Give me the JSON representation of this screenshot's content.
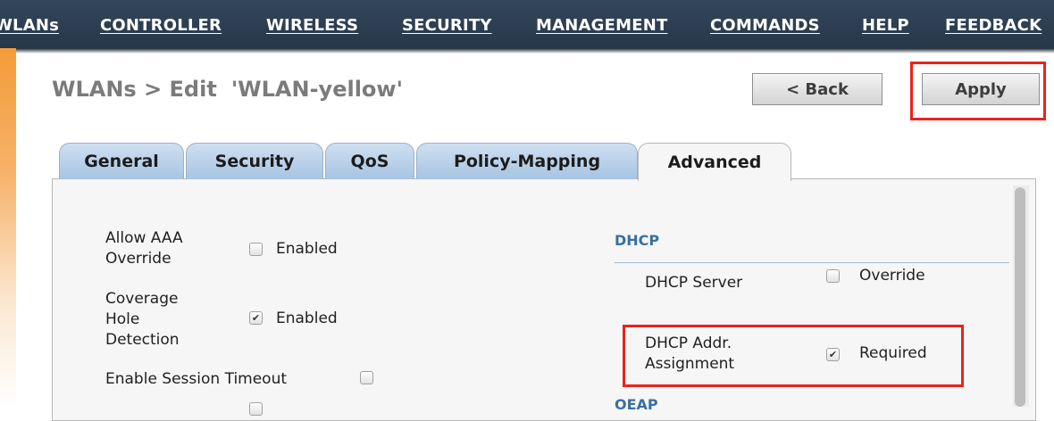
{
  "nav": {
    "items": [
      "WLANs",
      "CONTROLLER",
      "WIRELESS",
      "SECURITY",
      "MANAGEMENT",
      "COMMANDS",
      "HELP",
      "FEEDBACK"
    ]
  },
  "header": {
    "breadcrumb": "WLANs > Edit",
    "wlan_name": "'WLAN-yellow'",
    "back_label": "< Back",
    "apply_label": "Apply"
  },
  "tabs": [
    "General",
    "Security",
    "QoS",
    "Policy-Mapping",
    "Advanced"
  ],
  "active_tab": "Advanced",
  "left": {
    "allow_aaa_line1": "Allow AAA",
    "allow_aaa_line2": "Override",
    "allow_aaa_value": "Enabled",
    "allow_aaa_checked": false,
    "coverage_line1": "Coverage",
    "coverage_line2": "Hole",
    "coverage_line3": "Detection",
    "coverage_value": "Enabled",
    "coverage_checked": true,
    "session_timeout": "Enable Session Timeout",
    "session_timeout_checked": false
  },
  "dhcp": {
    "heading": "DHCP",
    "server_label": "DHCP Server",
    "server_value": "Override",
    "server_checked": false,
    "addr_line1": "DHCP Addr.",
    "addr_line2": "Assignment",
    "addr_value": "Required",
    "addr_checked": true,
    "next_heading_partial": "OEAP"
  },
  "colors": {
    "nav_bg": "#2d3f52",
    "highlight_red": "#e8231c",
    "tab_blue": "#b9d1ea",
    "section_blue": "#3a6fa0"
  }
}
